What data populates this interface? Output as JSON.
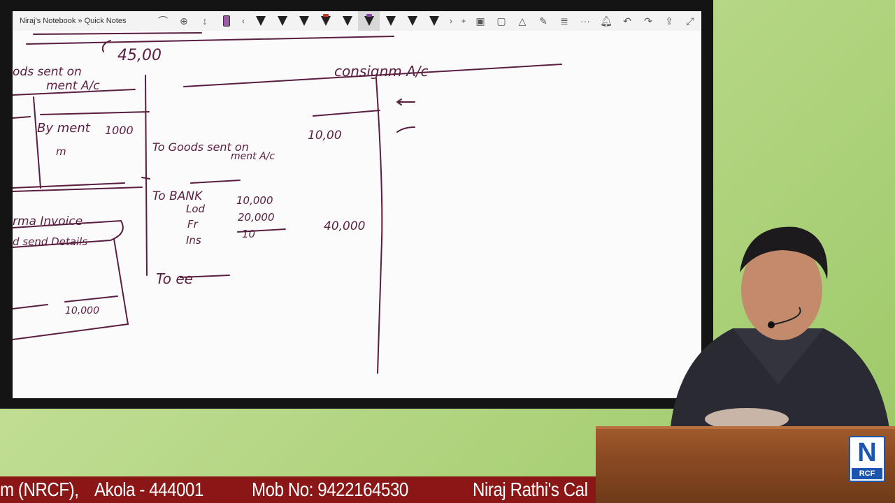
{
  "window": {
    "title": "Niraj's Notebook » Quick Notes"
  },
  "toolbar": {
    "icons": [
      "lasso-icon",
      "pan-icon",
      "insert-space-icon",
      "highlighter-icon",
      "scroll-left-icon",
      "pen-icon",
      "pen-icon",
      "pen-icon",
      "pen-icon",
      "pen-icon",
      "pen-icon",
      "pen-icon",
      "pen-icon",
      "pen-icon",
      "scroll-right-icon",
      "add-pen-icon",
      "shapes-icon",
      "lasso-select-icon",
      "ink-to-shape-icon",
      "ruler-icon",
      "ink-to-text-icon",
      "more-icon",
      "bell-icon",
      "undo-icon",
      "redo-icon",
      "share-icon",
      "collapse-icon"
    ],
    "pen_colors": [
      "#222222",
      "#222222",
      "#222222",
      "#222222",
      "#222222",
      "#7a3e8a",
      "#222222",
      "#222222",
      "#222222"
    ],
    "more_label": "···"
  },
  "notes": {
    "top_value": "45,00",
    "left_heading_1": "ods sent on",
    "left_heading_2": "ment A/c",
    "left_entry": "By ment",
    "left_entry_2": "m",
    "left_amount": "1000",
    "left_invoice": "rma Invoice",
    "left_invoice_2": "d send Details",
    "left_total": "10,000",
    "account_title": "consignm A/c",
    "row1_label": "To Goods sent on",
    "row1_label_2": "ment A/c",
    "row1_amount": "10,00",
    "row2_label": "To BANK",
    "row2_item1": "Lod",
    "row2_item1_amt": "10,000",
    "row2_item2": "Fr",
    "row2_item2_amt": "20,000",
    "row2_item3": "Ins",
    "row2_item3_amt": "10",
    "row2_total": "40,000",
    "row3_label": "To ee"
  },
  "branding": {
    "logo_letter": "N",
    "logo_sub": "RCF",
    "ticker_part1": "m (NRCF),",
    "ticker_part2": "Akola - 444001",
    "ticker_part3": "Mob No: 9422164530",
    "ticker_part4": "Niraj Rathi's Cal"
  },
  "colors": {
    "ink": "#5a1e40",
    "ticker_bg": "#8b1616",
    "logo_blue": "#1a56b0",
    "podium": "#8a4a22"
  }
}
